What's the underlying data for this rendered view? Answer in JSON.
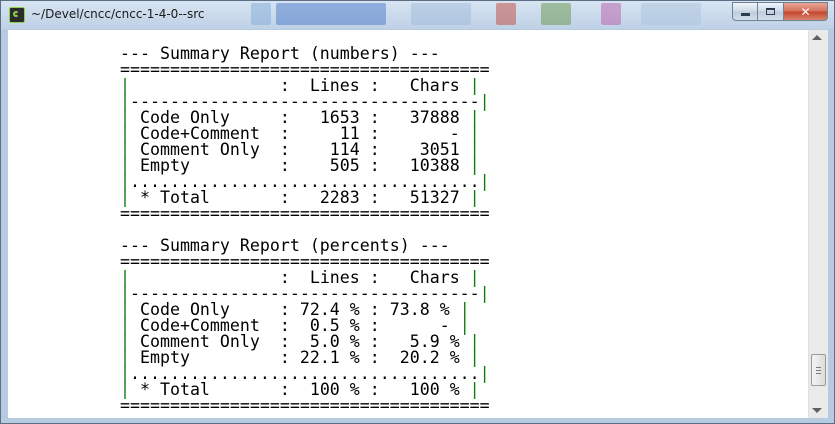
{
  "window": {
    "title": "~/Devel/cncc/cncc-1-4-0--src",
    "minimize_icon": "minimize-icon",
    "maximize_icon": "maximize-icon",
    "close_icon": "close-icon",
    "close_glyph": "✕",
    "app_icon": "terminal-app-icon"
  },
  "colors": {
    "titlebar": "#bfd1e6",
    "terminal_bg": "#ffffff",
    "terminal_text": "#000000",
    "table_border": "#0f7d0f",
    "close_button": "#c4432b"
  },
  "terminal": {
    "lines": [
      "--- Summary Report (numbers) ---",
      "=====================================",
      "|               :  Lines :   Chars |",
      "|-----------------------------------|",
      "| Code Only     :   1653 :   37888 |",
      "| Code+Comment  :     11 :       - |",
      "| Comment Only  :    114 :    3051 |",
      "| Empty         :    505 :   10388 |",
      "|...................................|",
      "| * Total       :   2283 :   51327 |",
      "=====================================",
      "",
      "--- Summary Report (percents) ---",
      "=====================================",
      "|               :  Lines :   Chars |",
      "|-----------------------------------|",
      "| Code Only     : 72.4 % : 73.8 % |",
      "| Code+Comment  :  0.5 % :      - |",
      "| Comment Only  :  5.0 % :   5.9 % |",
      "| Empty         : 22.1 % :  20.2 % |",
      "|...................................|",
      "| * Total       :  100 % :   100 % |",
      "====================================="
    ]
  },
  "scrollbar": {
    "up_icon": "scroll-up-arrow-icon",
    "down_icon": "scroll-down-arrow-icon",
    "position": 0.95
  }
}
